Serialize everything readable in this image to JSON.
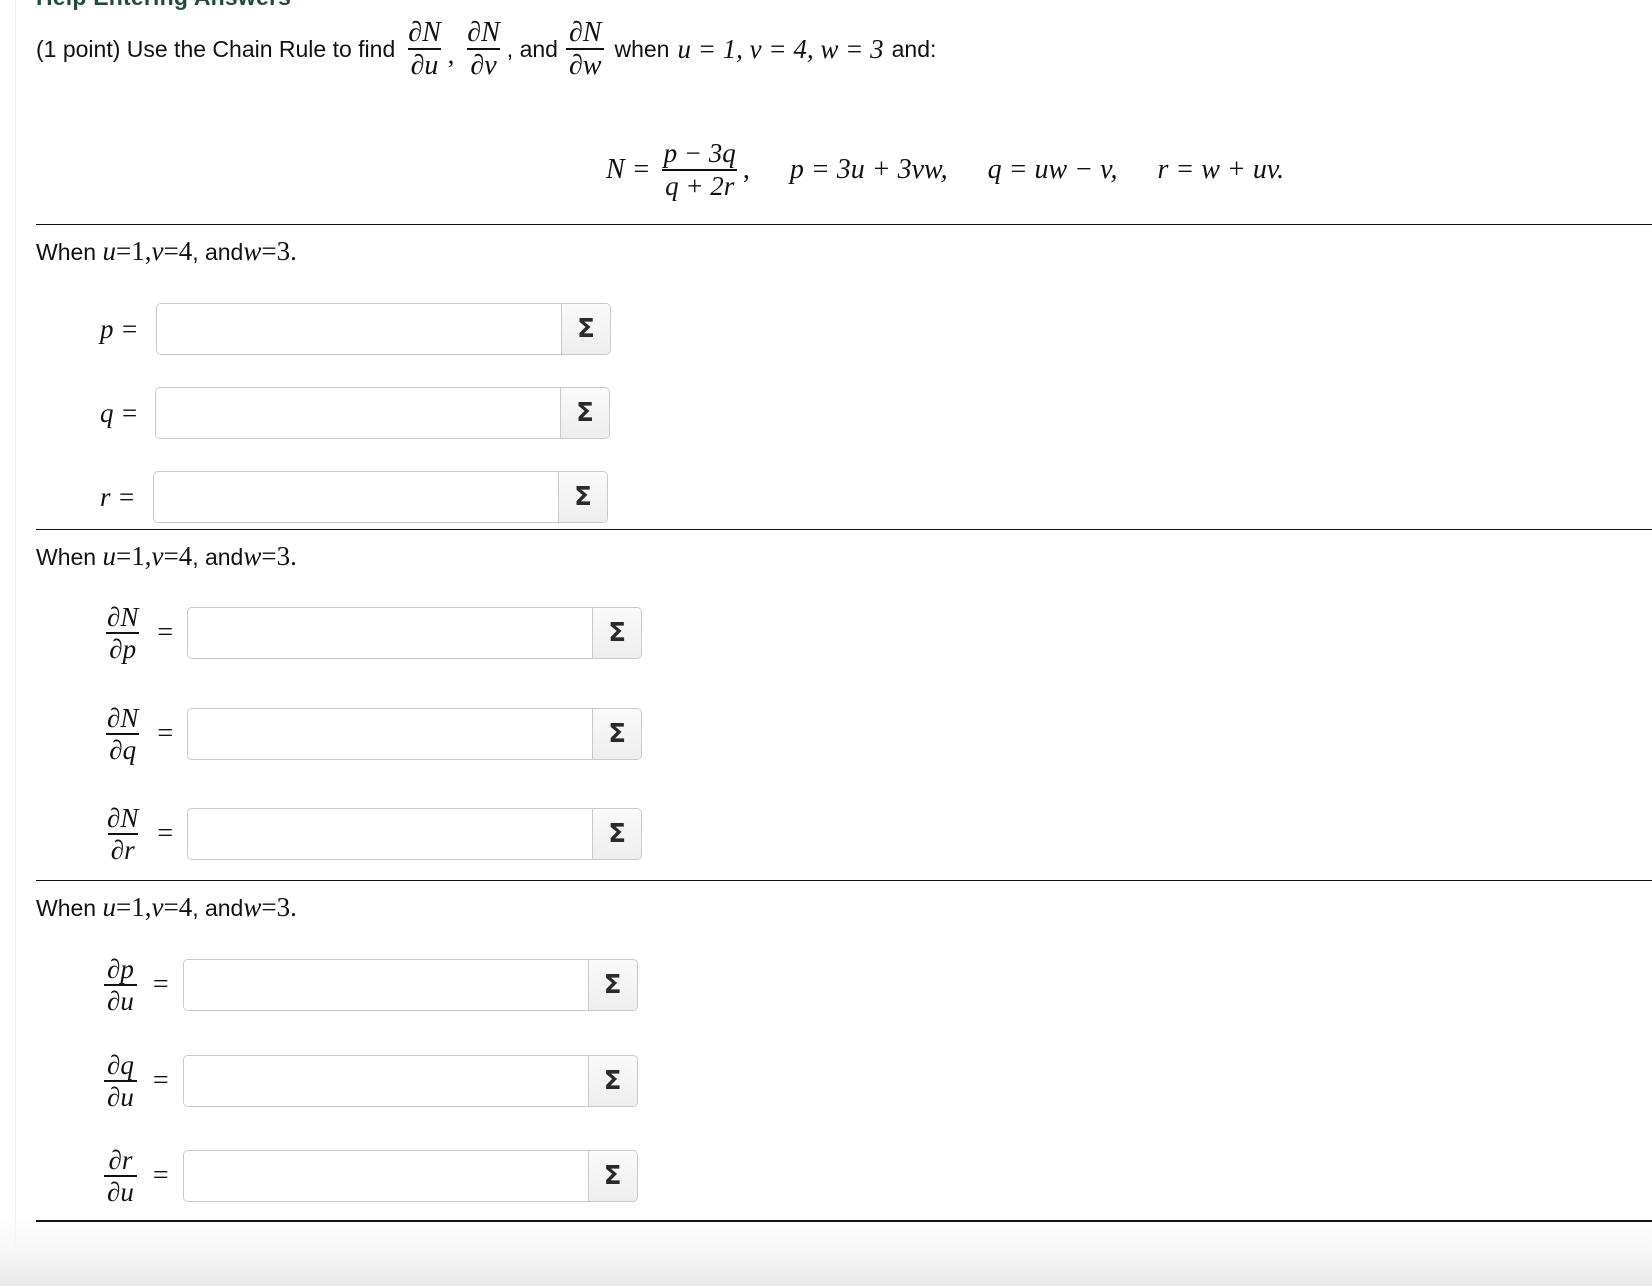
{
  "header": {
    "help_link": "Help Entering Answers"
  },
  "problem": {
    "intro": "(1 point) Use the Chain Rule to find",
    "partials": [
      {
        "num": "∂N",
        "den": "∂u"
      },
      {
        "num": "∂N",
        "den": "∂v"
      },
      {
        "num": "∂N",
        "den": "∂w"
      }
    ],
    "comma": ",",
    "and": ", and",
    "when_text": "when",
    "condition": "u = 1, v = 4, w = 3",
    "and_colon": "and:"
  },
  "definitions": {
    "N_lhs": "N =",
    "N_num": "p − 3q",
    "N_den": "q + 2r",
    "N_comma": ",",
    "p": "p = 3u + 3vw,",
    "q": "q = uw − v,",
    "r": "r = w + uv."
  },
  "sections": [
    {
      "when_prefix": "When",
      "when_vars": [
        "u",
        "v",
        "w"
      ],
      "when_vals": [
        "1",
        "4",
        "3"
      ],
      "rows": [
        {
          "label": "p =",
          "value": "",
          "sigma": "Σ"
        },
        {
          "label": "q =",
          "value": "",
          "sigma": "Σ"
        },
        {
          "label": "r =",
          "value": "",
          "sigma": "Σ"
        }
      ]
    },
    {
      "when_prefix": "When",
      "rows": [
        {
          "num": "∂N",
          "den": "∂p",
          "eq": "=",
          "value": "",
          "sigma": "Σ"
        },
        {
          "num": "∂N",
          "den": "∂q",
          "eq": "=",
          "value": "",
          "sigma": "Σ"
        },
        {
          "num": "∂N",
          "den": "∂r",
          "eq": "=",
          "value": "",
          "sigma": "Σ"
        }
      ]
    },
    {
      "when_prefix": "When",
      "rows": [
        {
          "num": "∂p",
          "den": "∂u",
          "eq": "=",
          "value": "",
          "sigma": "Σ"
        },
        {
          "num": "∂q",
          "den": "∂u",
          "eq": "=",
          "value": "",
          "sigma": "Σ"
        },
        {
          "num": "∂r",
          "den": "∂u",
          "eq": "=",
          "value": "",
          "sigma": "Σ"
        }
      ]
    }
  ],
  "when_text": {
    "u": "u",
    "v": "v",
    "w": "w",
    "eq": " = ",
    "u_val": "1",
    "v_val": "4",
    "w_val": "3",
    "sep1": ", ",
    "and": ", and ",
    "end": "."
  },
  "colors": {
    "header_link": "#234a36",
    "rule": "#111111",
    "input_border": "#c9c9c9"
  }
}
